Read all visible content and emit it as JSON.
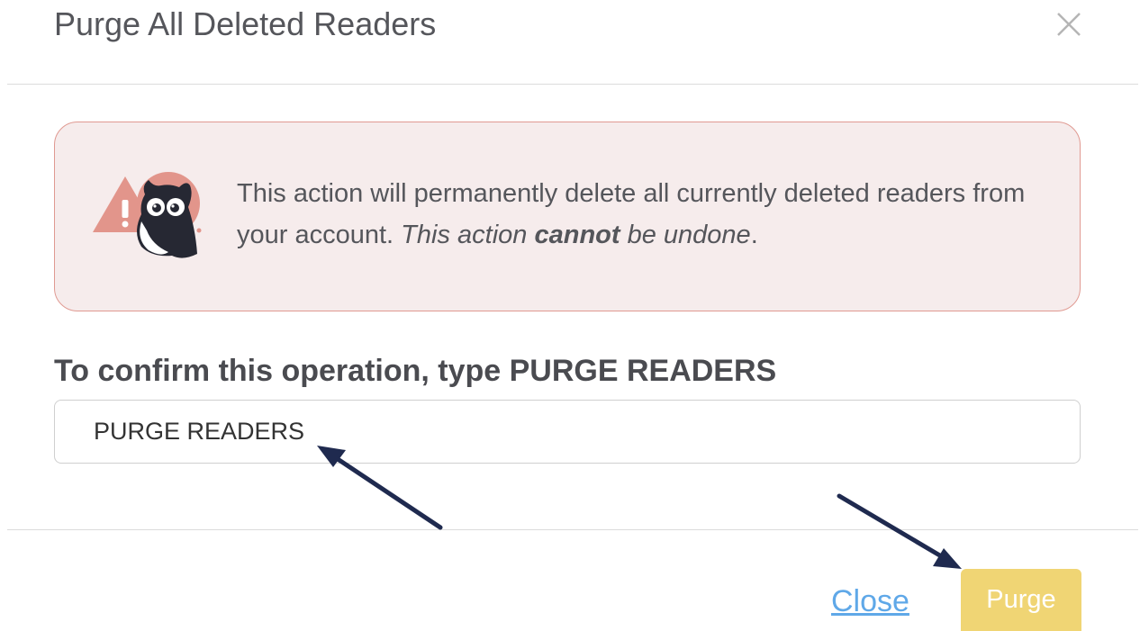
{
  "dialog": {
    "title": "Purge All Deleted Readers",
    "close_icon": "close-x-icon"
  },
  "alert": {
    "icon": "owl-warning-icon",
    "text_plain": "This action will permanently delete all currently deleted readers from your account.",
    "text_em_prefix": "This action",
    "text_strong": "cannot",
    "text_em_suffix": "be undone",
    "text_end": "."
  },
  "confirm": {
    "label": "To confirm this operation, type PURGE READERS",
    "input_value": "PURGE READERS"
  },
  "footer": {
    "close_label": "Close",
    "purge_label": "Purge"
  },
  "colors": {
    "alert_bg": "#f6ecec",
    "alert_border": "#e09a92",
    "link": "#5fa8e8",
    "purge_button": "#f0d574",
    "annotation_arrow": "#1f2a4f"
  }
}
